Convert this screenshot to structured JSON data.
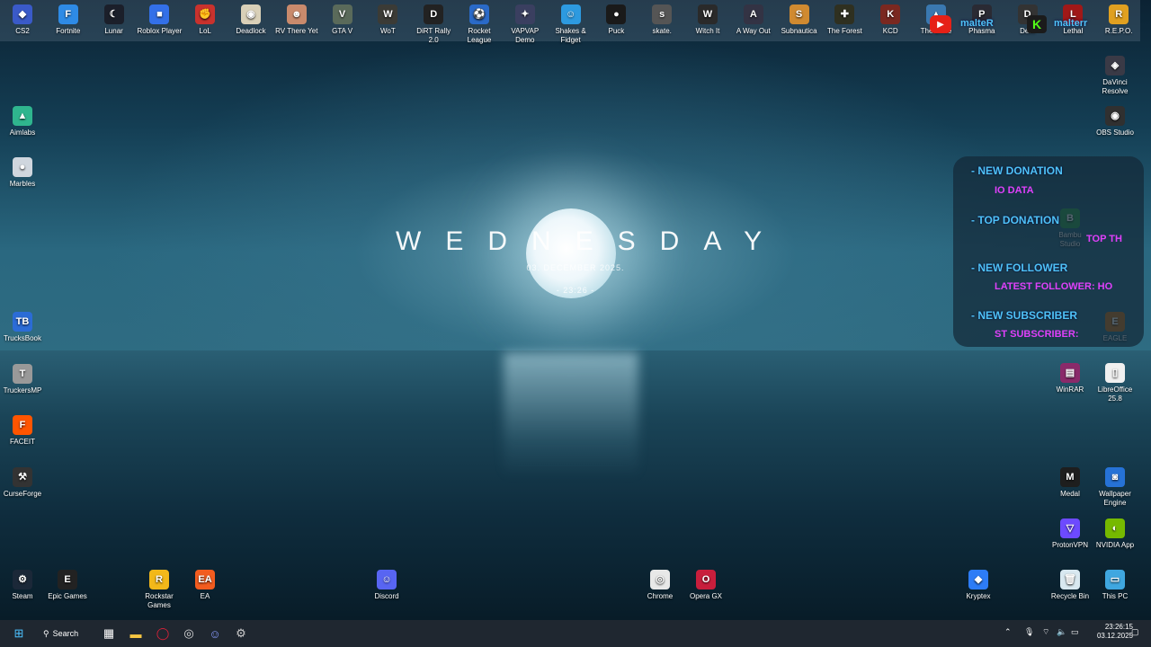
{
  "wallpaper": {
    "day": "WEDNESDAY",
    "date": "03. DECEMBER 2025.",
    "time": "- 23:26 -"
  },
  "top_icons": [
    {
      "label": "CS2",
      "color": "#3a5ac8",
      "glyph": "◆"
    },
    {
      "label": "Fortnite",
      "color": "#2e8be6",
      "glyph": "F"
    },
    {
      "label": "Lunar",
      "color": "#1b1f2a",
      "glyph": "☾"
    },
    {
      "label": "Roblox Player",
      "color": "#3370e8",
      "glyph": "■"
    },
    {
      "label": "LoL",
      "color": "#c9322d",
      "glyph": "✊"
    },
    {
      "label": "Deadlock",
      "color": "#d9d0b8",
      "glyph": "◉"
    },
    {
      "label": "RV There Yet",
      "color": "#c98a6c",
      "glyph": "☻"
    },
    {
      "label": "GTA V",
      "color": "#5a6a5a",
      "glyph": "V"
    },
    {
      "label": "WoT",
      "color": "#3b3b36",
      "glyph": "W"
    },
    {
      "label": "DiRT Rally 2.0",
      "color": "#222",
      "glyph": "D"
    },
    {
      "label": "Rocket League",
      "color": "#2a6ac8",
      "glyph": "⚽"
    },
    {
      "label": "VAPVAP Demo",
      "color": "#3a3f60",
      "glyph": "✦"
    },
    {
      "label": "Shakes & Fidget",
      "color": "#2d9ae0",
      "glyph": "☺"
    },
    {
      "label": "Puck",
      "color": "#1a1a1a",
      "glyph": "●"
    },
    {
      "label": "skate.",
      "color": "#555",
      "glyph": "s"
    },
    {
      "label": "Witch It",
      "color": "#2a2a2a",
      "glyph": "W"
    },
    {
      "label": "A Way Out",
      "color": "#334",
      "glyph": "A"
    },
    {
      "label": "Subnautica",
      "color": "#d08a30",
      "glyph": "S"
    },
    {
      "label": "The Forest",
      "color": "#2f3020",
      "glyph": "✚"
    },
    {
      "label": "KCD",
      "color": "#7a2820",
      "glyph": "K"
    },
    {
      "label": "The Drive",
      "color": "#3a78b0",
      "glyph": "▲"
    },
    {
      "label": "Phasma",
      "color": "#2a2a33",
      "glyph": "P"
    },
    {
      "label": "Dem",
      "color": "#333",
      "glyph": "D"
    },
    {
      "label": "Lethal",
      "color": "#a01818",
      "glyph": "L"
    },
    {
      "label": "R.E.P.O.",
      "color": "#e0a020",
      "glyph": "R"
    }
  ],
  "left_icons": [
    {
      "label": "Aimlabs",
      "color": "#2fb58e",
      "glyph": "▲"
    },
    {
      "label": "Marbles",
      "color": "#cfd6de",
      "glyph": "●"
    },
    {
      "label": "TrucksBook",
      "color": "#2b6cd6",
      "glyph": "TB"
    },
    {
      "label": "TruckersMP",
      "color": "#999",
      "glyph": "T"
    },
    {
      "label": "FACEIT",
      "color": "#ff5500",
      "glyph": "F"
    },
    {
      "label": "CurseForge",
      "color": "#333",
      "glyph": "⚒"
    },
    {
      "label": "Steam",
      "color": "#1b2838",
      "glyph": "⚙"
    }
  ],
  "bottom_icons": [
    {
      "label": "Epic Games",
      "color": "#222",
      "glyph": "E"
    },
    {
      "label": "Rockstar Games",
      "color": "#f2b81a",
      "glyph": "R"
    },
    {
      "label": "EA",
      "color": "#f25c1f",
      "glyph": "EA"
    },
    {
      "label": "Discord",
      "color": "#5865f2",
      "glyph": "☺"
    },
    {
      "label": "Chrome",
      "color": "#e8e8e8",
      "glyph": "◎"
    },
    {
      "label": "Opera GX",
      "color": "#c81e3c",
      "glyph": "O"
    },
    {
      "label": "Kryptex",
      "color": "#2d7cf6",
      "glyph": "◆"
    }
  ],
  "right_icons": [
    {
      "label": "DaVinci Resolve",
      "color": "#3a3a46",
      "glyph": "◈"
    },
    {
      "label": "OBS Studio",
      "color": "#303030",
      "glyph": "◉"
    },
    {
      "label": "Bambu Studio",
      "color": "#2e9e4e",
      "glyph": "B"
    },
    {
      "label": "EAGLE",
      "color": "#c0701c",
      "glyph": "E"
    },
    {
      "label": "WinRAR",
      "color": "#8a2a6a",
      "glyph": "▤"
    },
    {
      "label": "LibreOffice 25.8",
      "color": "#f0f0f0",
      "glyph": "▯"
    },
    {
      "label": "Medal",
      "color": "#1e1e1e",
      "glyph": "M"
    },
    {
      "label": "Wallpaper Engine",
      "color": "#2672d6",
      "glyph": "◙"
    },
    {
      "label": "ProtonVPN",
      "color": "#6d4aff",
      "glyph": "▽"
    },
    {
      "label": "NVIDIA App",
      "color": "#76b900",
      "glyph": "◐"
    },
    {
      "label": "Recycle Bin",
      "color": "#d8e8f0",
      "glyph": "🗑"
    },
    {
      "label": "This PC",
      "color": "#3fa7e0",
      "glyph": "▭"
    }
  ],
  "overlay": {
    "new_donation": "- NEW DONATION",
    "new_donation_value": "IO DATA",
    "top_donation": "- TOP DONATION",
    "top_donation_value": "TOP TH",
    "new_follower": "- NEW FOLLOWER",
    "new_follower_value": "LATEST FOLLOWER: HO",
    "new_subscriber": "- NEW SUBSCRIBER",
    "new_subscriber_value": "ST SUBSCRIBER:",
    "brand1": "malteR",
    "brand2": "malterr"
  },
  "taskbar": {
    "search_label": "Search",
    "time": "23:26:15",
    "date": "03.12.2025"
  }
}
